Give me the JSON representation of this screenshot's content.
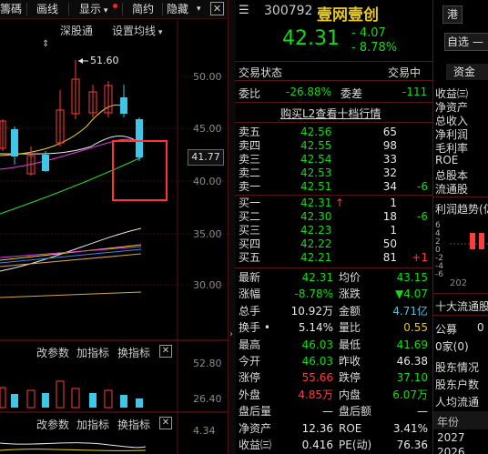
{
  "toolbar": {
    "items": [
      "籌碼",
      "画线",
      "显示",
      "简约",
      "隐藏"
    ],
    "more_icon": "close-icon"
  },
  "chart_top": {
    "link": "深股通",
    "ma_setting": "设置均线",
    "max_label": "51.60",
    "price_ticks": [
      "50.00",
      "45.00",
      "40.00",
      "35.00",
      "30.00"
    ],
    "current_price_tag": "41.77"
  },
  "indicator1": {
    "params": "改参数",
    "add": "加指标",
    "switch": "换指标",
    "ticks": [
      "52.80",
      "26.40"
    ]
  },
  "indicator2": {
    "params": "改参数",
    "add": "加指标",
    "switch": "换指标",
    "ticks": [
      "4.34"
    ]
  },
  "stock": {
    "code": "300792",
    "name": "壹网壹创",
    "hk_badge": "港",
    "price": "42.31",
    "change": "- 4.07",
    "change_pct": "- 8.78%",
    "watch_btn": "自选 —"
  },
  "status": {
    "label": "交易状态",
    "value": "交易中"
  },
  "ratio": {
    "wb_label": "委比",
    "wb_value": "-26.88%",
    "wc_label": "委差",
    "wc_value": "-111"
  },
  "l2_link": "购买L2查看十档行情",
  "asks": [
    {
      "label": "卖五",
      "price": "42.56",
      "vol": "65",
      "chg": ""
    },
    {
      "label": "卖四",
      "price": "42.55",
      "vol": "98",
      "chg": ""
    },
    {
      "label": "卖三",
      "price": "42.54",
      "vol": "33",
      "chg": ""
    },
    {
      "label": "卖二",
      "price": "42.53",
      "vol": "32",
      "chg": ""
    },
    {
      "label": "卖一",
      "price": "42.51",
      "vol": "34",
      "chg": "-6"
    }
  ],
  "bids": [
    {
      "label": "买一",
      "price": "42.31",
      "vol": "1",
      "chg": ""
    },
    {
      "label": "买二",
      "price": "42.30",
      "vol": "18",
      "chg": "-6"
    },
    {
      "label": "买三",
      "price": "42.23",
      "vol": "1",
      "chg": ""
    },
    {
      "label": "买四",
      "price": "42.22",
      "vol": "50",
      "chg": ""
    },
    {
      "label": "买五",
      "price": "42.21",
      "vol": "81",
      "chg": "+1"
    }
  ],
  "stats": [
    {
      "l1": "最新",
      "v1": "42.31",
      "c1": "green",
      "l2": "均价",
      "v2": "43.15",
      "c2": "green"
    },
    {
      "l1": "涨幅",
      "v1": "-8.78%",
      "c1": "green",
      "l2": "涨跌",
      "v2": "▼4.07",
      "c2": "green"
    },
    {
      "l1": "总手",
      "v1": "10.92万",
      "c1": "white",
      "l2": "金额",
      "v2": "4.71亿",
      "c2": "cyan"
    },
    {
      "l1": "换手 •",
      "v1": "5.14%",
      "c1": "white",
      "l2": "量比",
      "v2": "0.55",
      "c2": "yellow"
    },
    {
      "l1": "最高",
      "v1": "46.03",
      "c1": "green",
      "l2": "最低",
      "v2": "41.69",
      "c2": "green"
    },
    {
      "l1": "今开",
      "v1": "46.03",
      "c1": "green",
      "l2": "昨收",
      "v2": "46.38",
      "c2": "white"
    },
    {
      "l1": "涨停",
      "v1": "55.66",
      "c1": "red",
      "l2": "跌停",
      "v2": "37.10",
      "c2": "green"
    },
    {
      "l1": "外盘",
      "v1": "4.85万",
      "c1": "red",
      "l2": "内盘",
      "v2": "6.07万",
      "c2": "green"
    },
    {
      "l1": "盘后量",
      "v1": "—",
      "c1": "white",
      "l2": "盘后额",
      "v2": "—",
      "c2": "white"
    },
    {
      "l1": "净资产",
      "v1": "12.36",
      "c1": "white",
      "l2": "ROE",
      "v2": "3.41%",
      "c2": "white"
    },
    {
      "l1": "收益㈢",
      "v1": "0.416",
      "c1": "white",
      "l2": "PE(动)",
      "v2": "76.36",
      "c2": "white"
    }
  ],
  "right_panel": {
    "tab": "资金",
    "rows": [
      "收益㈢",
      "净资产",
      "总收入",
      "净利润",
      "毛利率",
      "ROE",
      "总股本",
      "流通股"
    ],
    "trend_title": "利润趋势(亿",
    "trend_ticks": [
      "6",
      "4",
      "2",
      "0",
      "-2",
      "-4",
      "-6"
    ],
    "trend_year": "202",
    "holders_title": "十大流通股",
    "holders_rows": [
      "公募",
      "0家(0)",
      "股东情况",
      "股东户数",
      "人均流通"
    ],
    "holders_zero": "0",
    "bottom_rows": [
      "年份",
      "2027",
      "2026"
    ]
  }
}
